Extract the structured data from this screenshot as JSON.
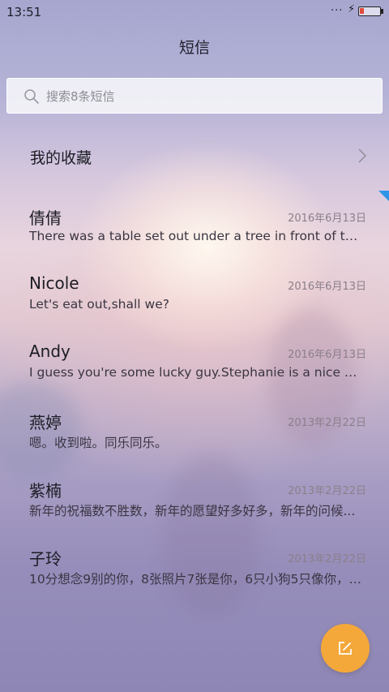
{
  "status_bar": {
    "time": "13:51",
    "dots": "...",
    "charging_symbol": "⚡",
    "battery_level": 0.2
  },
  "header": {
    "title": "短信"
  },
  "search": {
    "placeholder": "搜索8条短信"
  },
  "favorites": {
    "label": "我的收藏"
  },
  "threads": [
    {
      "name": "倩倩",
      "date": "2016年6月13日",
      "preview": "There was a table set out under a tree in front of the ho.."
    },
    {
      "name": "Nicole",
      "date": "2016年6月13日",
      "preview": "Let's eat out,shall we?"
    },
    {
      "name": "Andy",
      "date": "2016年6月13日",
      "preview": "I guess you're some lucky guy.Stephanie is a nice girl."
    },
    {
      "name": "燕婷",
      "date": "2013年2月22日",
      "preview": "嗯。收到啦。同乐同乐。"
    },
    {
      "name": "紫楠",
      "date": "2013年2月22日",
      "preview": "新年的祝福数不胜数，新年的愿望好多好多，新年的问候..."
    },
    {
      "name": "子玲",
      "date": "2013年2月22日",
      "preview": "10分想念9别的你，8张照片7张是你，6只小狗5只像你，4..."
    }
  ],
  "fab": {
    "icon": "compose-icon",
    "color": "#f4a83a"
  },
  "accent_colors": {
    "battery_low": "#e24b3b",
    "corner_marker": "#2e95e8"
  }
}
